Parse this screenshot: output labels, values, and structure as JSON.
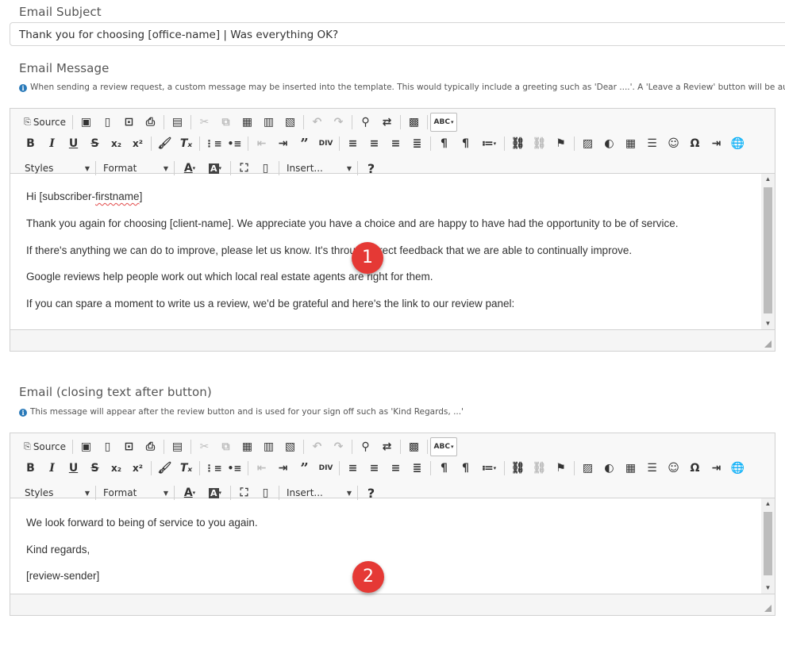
{
  "subject": {
    "label": "Email Subject",
    "value": "Thank you for choosing [office-name] | Was everything OK?"
  },
  "message": {
    "label": "Email Message",
    "hint": "When sending a review request, a custom message may be inserted into the template. This would typically include a greeting such as 'Dear ....'. A 'Leave a Review' button will be autor",
    "lines": [
      "Hi [subscriber-",
      "firstname",
      "]",
      "Thank you again for choosing [client-name]. We appreciate you have a choice and are happy to have had the opportunity to be of service.",
      "If there's anything we can do to improve, please let us know. It's through direct feedback that we are able to continually improve.",
      "Google reviews help people work out which local real estate agents are right for them.",
      "If you can spare a moment to write us a review, we'd be grateful and here's the link to our review panel:"
    ]
  },
  "closing": {
    "label": "Email (closing text after button)",
    "hint": "This message will appear after the review button and is used for your sign off such as 'Kind Regards, ...'",
    "lines": [
      "We look forward to being of service to you again.",
      "Kind regards,",
      "[review-sender]"
    ]
  },
  "toolbar": {
    "source_label": "Source",
    "styles_label": "Styles",
    "format_label": "Format",
    "insert_label": "Insert...",
    "help_label": "?"
  },
  "badges": [
    "1",
    "2"
  ],
  "colors": {
    "badge": "#e53935",
    "info": "#2a7ab9",
    "spellcheck_underline": "#e24a4a"
  }
}
